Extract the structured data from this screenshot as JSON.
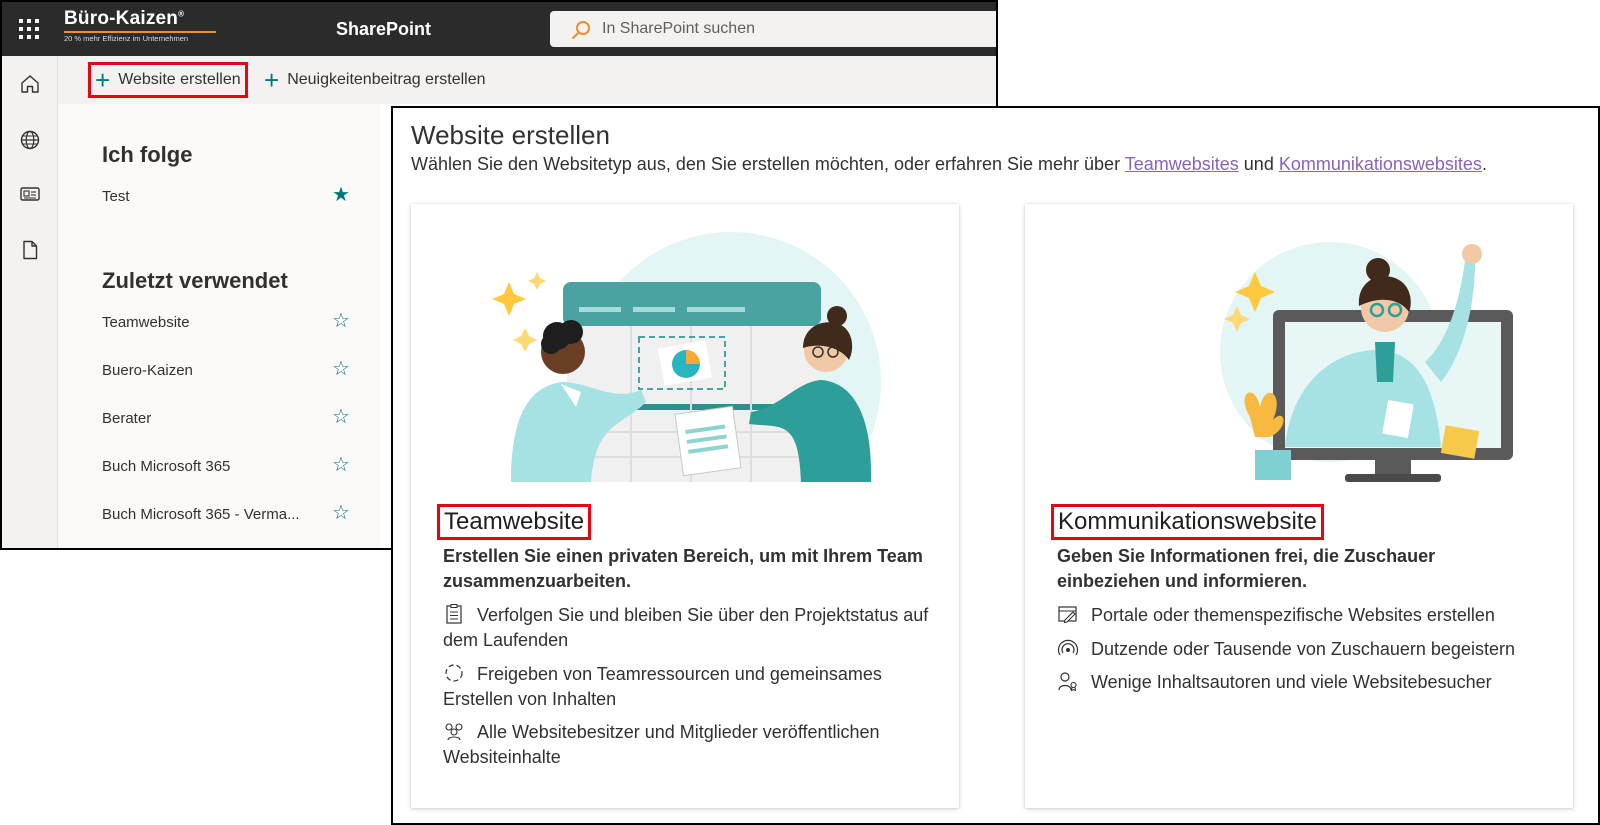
{
  "suite": {
    "logo_name": "Büro-Kaizen",
    "logo_mark": "®",
    "logo_tagline": "20 % mehr Effizienz im Unternehmen",
    "app_title": "SharePoint",
    "search_placeholder": "In SharePoint suchen"
  },
  "rail": {
    "icons": [
      "home-icon",
      "globe-icon",
      "news-icon",
      "document-icon"
    ]
  },
  "command_bar": {
    "create_site": "Website erstellen",
    "create_news": "Neuigkeitenbeitrag erstellen"
  },
  "sidebar": {
    "following_heading": "Ich folge",
    "following": [
      {
        "label": "Test",
        "starred": true
      }
    ],
    "recent_heading": "Zuletzt verwendet",
    "recent": [
      {
        "label": "Teamwebsite",
        "starred": false
      },
      {
        "label": "Buero-Kaizen",
        "starred": false
      },
      {
        "label": "Berater",
        "starred": false
      },
      {
        "label": "Buch Microsoft 365",
        "starred": false
      },
      {
        "label": "Buch Microsoft 365 - Verma...",
        "starred": false
      }
    ]
  },
  "dialog": {
    "title": "Website erstellen",
    "desc_prefix": "Wählen Sie den Websitetyp aus, den Sie erstellen möchten, oder erfahren Sie mehr über ",
    "link_team": "Teamwebsites",
    "desc_and": " und ",
    "link_comm": "Kommunikationswebsites",
    "desc_suffix": "."
  },
  "cards": {
    "team": {
      "title": "Teamwebsite",
      "subtitle": "Erstellen Sie einen privaten Bereich, um mit Ihrem Team zusammenzuarbeiten.",
      "features": [
        "Verfolgen Sie und bleiben Sie über den Projektstatus auf dem Laufenden",
        "Freigeben von Teamressourcen und gemeinsames Erstellen von Inhalten",
        "Alle Websitebesitzer und Mitglieder veröffentlichen Websiteinhalte"
      ]
    },
    "communication": {
      "title": "Kommunikationswebsite",
      "subtitle": "Geben Sie Informationen frei, die Zuschauer einbeziehen und informieren.",
      "features": [
        "Portale oder themenspezifische Websites erstellen",
        "Dutzende oder Tausende von Zuschauern begeistern",
        "Wenige Inhaltsautoren und viele Websitebesucher"
      ]
    }
  },
  "colors": {
    "accent": "#03787c",
    "highlight": "#e30613",
    "link": "#8764b8",
    "suite_bar": "#2b2b2b"
  }
}
